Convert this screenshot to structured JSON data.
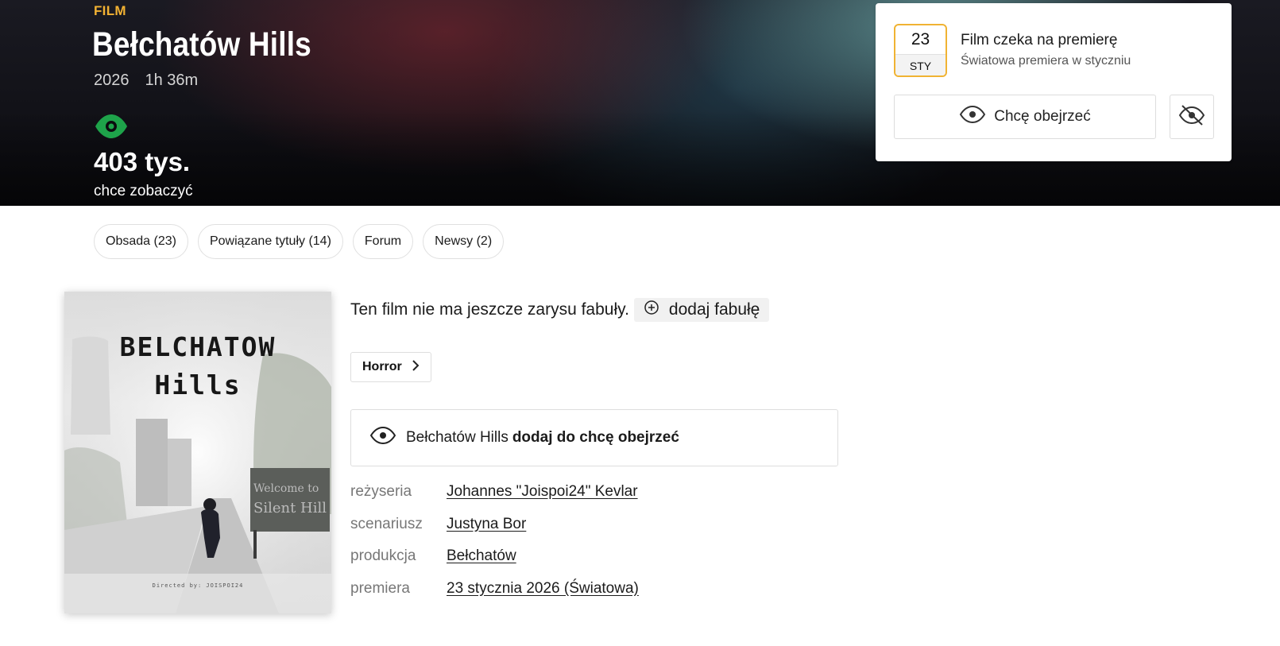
{
  "hero": {
    "type_label": "FILM",
    "title": "Bełchatów Hills",
    "year": "2026",
    "duration": "1h 36m",
    "wants_count": "403 tys.",
    "wants_label": "chce zobaczyć",
    "eye_color": "#1ea34a"
  },
  "premiere_card": {
    "day": "23",
    "month": "STY",
    "title": "Film czeka na premierę",
    "subtitle": "Światowa premiera w styczniu",
    "want_label": "Chcę obejrzeć",
    "accent_color": "#f0b333"
  },
  "tabs": [
    {
      "label": "Obsada (23)"
    },
    {
      "label": "Powiązane tytuły (14)"
    },
    {
      "label": "Forum"
    },
    {
      "label": "Newsy (2)"
    }
  ],
  "poster": {
    "title_line1": "BELCHATOW",
    "title_line2": "Hills",
    "sign_line1": "Welcome to",
    "sign_line2": "Silent Hill",
    "credit": "Directed by: JOISPOI24"
  },
  "plot": {
    "text": "Ten film nie ma jeszcze zarysu fabuły.",
    "add_label": "dodaj fabułę"
  },
  "genre": "Horror",
  "watchlist": {
    "title": "Bełchatów Hills",
    "action": "dodaj do chcę obejrzeć"
  },
  "crew": [
    {
      "label": "reżyseria",
      "value": "Johannes \"Joispoi24\" Kevlar"
    },
    {
      "label": "scenariusz",
      "value": "Justyna Bor"
    },
    {
      "label": "produkcja",
      "value": "Bełchatów"
    },
    {
      "label": "premiera",
      "value": "23 stycznia 2026 (Światowa)"
    }
  ]
}
